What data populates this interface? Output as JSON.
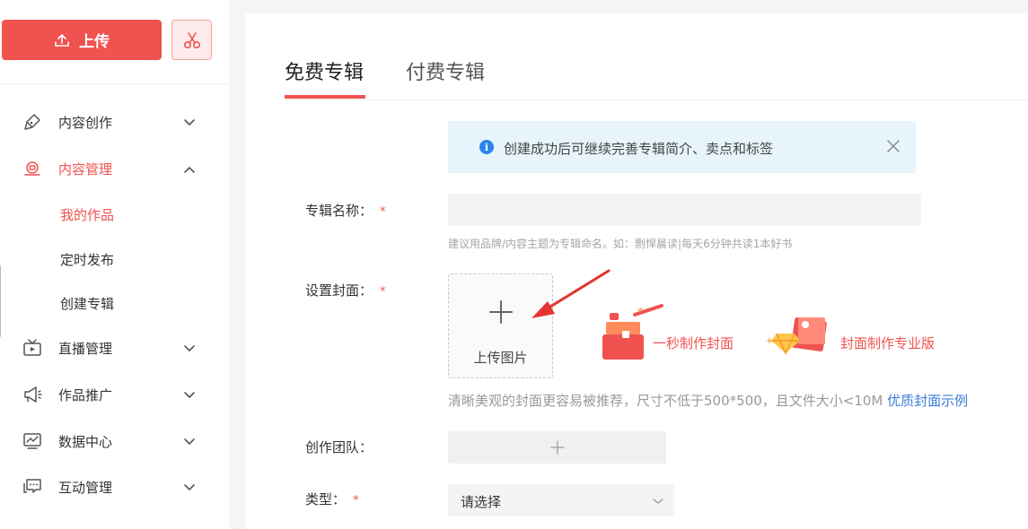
{
  "sidebar": {
    "upload_label": "上传",
    "menu": [
      {
        "label": "内容创作",
        "icon": "pen-nib-icon",
        "expanded": false
      },
      {
        "label": "内容管理",
        "icon": "content-manage-icon",
        "expanded": true
      },
      {
        "label": "直播管理",
        "icon": "tv-icon",
        "expanded": false
      },
      {
        "label": "作品推广",
        "icon": "megaphone-icon",
        "expanded": false
      },
      {
        "label": "数据中心",
        "icon": "chart-icon",
        "expanded": false
      },
      {
        "label": "互动管理",
        "icon": "chat-icon",
        "expanded": false
      }
    ],
    "sub_items": [
      {
        "label": "我的作品",
        "active": true
      },
      {
        "label": "定时发布",
        "active": false
      },
      {
        "label": "创建专辑",
        "active": false
      }
    ]
  },
  "tabs": [
    {
      "label": "免费专辑",
      "active": true
    },
    {
      "label": "付费专辑",
      "active": false
    }
  ],
  "notice": {
    "text": "创建成功后可继续完善专辑简介、卖点和标签"
  },
  "form": {
    "name_label": "专辑名称：",
    "name_value": "",
    "name_hint": "建议用品牌/内容主题为专辑命名。如：剽悍晨读|每天6分钟共读1本好书",
    "cover_label": "设置封面：",
    "cover_upload_text": "上传图片",
    "quick_cover_text": "一秒制作封面",
    "pro_cover_text": "封面制作专业版",
    "cover_hint": "清晰美观的封面更容易被推荐，尺寸不低于500*500，且文件大小<10M",
    "cover_example_link": "优质封面示例",
    "team_label": "创作团队：",
    "type_label": "类型：",
    "type_value": "请选择",
    "required_mark": "*"
  },
  "colors": {
    "accent": "#f0524f",
    "info": "#2a84e8",
    "link": "#3b7dd8"
  }
}
